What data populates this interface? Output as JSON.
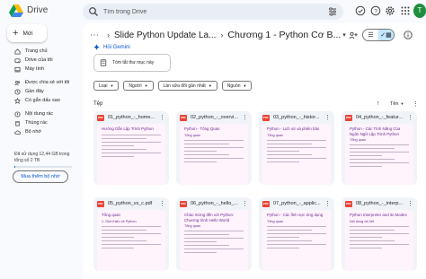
{
  "header": {
    "app_name": "Drive",
    "search_placeholder": "Tìm trong Drive",
    "avatar_letter": "T"
  },
  "sidebar": {
    "new_label": "Mới",
    "items": [
      {
        "label": "Trang chủ",
        "icon": "home-icon"
      },
      {
        "label": "Drive của tôi",
        "icon": "my-drive-icon"
      },
      {
        "label": "Máy tính",
        "icon": "computer-icon"
      },
      {
        "label": "Được chia sẻ với tôi",
        "icon": "shared-icon"
      },
      {
        "label": "Gần đây",
        "icon": "recent-icon"
      },
      {
        "label": "Có gắn dấu sao",
        "icon": "star-icon"
      },
      {
        "label": "Nội dung rác",
        "icon": "spam-icon"
      },
      {
        "label": "Thùng rác",
        "icon": "trash-icon"
      },
      {
        "label": "Bộ nhớ",
        "icon": "cloud-icon"
      }
    ],
    "storage_text": "Đã sử dụng 12,44 GB trong tổng số 2 TB",
    "storage_used_fraction": 0.006,
    "buy_storage": "Mua thêm bộ nhớ"
  },
  "main": {
    "breadcrumb_parent": "Slide Python Update La...",
    "breadcrumb_current": "Chương 1 - Python Cơ B...",
    "gemini_label": "Hỏi Gemini",
    "summary_label": "Tóm tắt thư mục này",
    "filters": [
      "Loại",
      "Người",
      "Lần sửa đổi gần nhất",
      "Nguồn"
    ],
    "section_title": "Tệp",
    "sort_label": "Tên"
  },
  "files": [
    {
      "name": "01_python_-_home...",
      "thumb_title": "Hướng Dẫn Lập Trình Python",
      "thumb_sub": ""
    },
    {
      "name": "02_python_-_overvi...",
      "thumb_title": "Python - Tổng Quan",
      "thumb_sub": "Tổng quan"
    },
    {
      "name": "03_python_-_histor...",
      "thumb_title": "Python - Lịch sử và phiên bản",
      "thumb_sub": "Tổng quan"
    },
    {
      "name": "04_python_-_featur...",
      "thumb_title": "Python - Các Tính Năng Của Ngôn Ngữ Lập Trình Python",
      "thumb_sub": "Tổng quan"
    },
    {
      "name": "05_python_vs_c.pdf",
      "thumb_title": "Tổng quan",
      "thumb_sub": "1. Giới thiệu về Python"
    },
    {
      "name": "06_python_-_hello_...",
      "thumb_title": "Chào mừng đến với Python: Chương trình Hello World",
      "thumb_sub": "Tổng quan"
    },
    {
      "name": "07_python_-_applic...",
      "thumb_title": "Python - Các lĩnh vực ứng dụng",
      "thumb_sub": "Tổng quan"
    },
    {
      "name": "08_python_-_interp...",
      "thumb_title": "Python Interpreter and its Modes",
      "thumb_sub": "Nội dung chi tiết"
    }
  ]
}
